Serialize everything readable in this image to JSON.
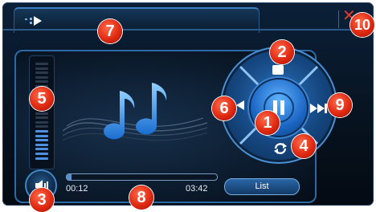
{
  "player": {
    "elapsed": "00:12",
    "duration": "03:42",
    "progress": 0.03,
    "list_label": "List",
    "volume_level": 0.3
  },
  "icons": {
    "tab_arrow": "arrow-right-icon",
    "volume": "speaker-icon",
    "music": "music-note-icon",
    "play_pause": "pause-icon",
    "previous": "skip-previous-icon",
    "next": "skip-next-icon",
    "repeat": "repeat-icon",
    "stop": "stop-icon",
    "close": "close-icon"
  },
  "callouts": [
    "1",
    "2",
    "3",
    "4",
    "5",
    "6",
    "7",
    "8",
    "9",
    "10"
  ],
  "colors": {
    "accent": "#2b6aa6",
    "ring": "#15467f",
    "callout": "#e02a12"
  }
}
